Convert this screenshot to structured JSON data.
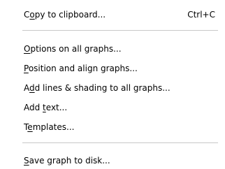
{
  "menu": {
    "items": [
      {
        "pre": "C",
        "mn": "o",
        "post": "py to clipboard...",
        "shortcut": "Ctrl+C"
      },
      {
        "pre": "",
        "mn": "O",
        "post": "ptions on all graphs...",
        "shortcut": ""
      },
      {
        "pre": "",
        "mn": "P",
        "post": "osition and align graphs...",
        "shortcut": ""
      },
      {
        "pre": "A",
        "mn": "d",
        "post": "d lines & shading to all graphs...",
        "shortcut": ""
      },
      {
        "pre": "Add ",
        "mn": "t",
        "post": "ext...",
        "shortcut": ""
      },
      {
        "pre": "T",
        "mn": "e",
        "post": "mplates...",
        "shortcut": ""
      },
      {
        "pre": "",
        "mn": "S",
        "post": "ave graph to disk...",
        "shortcut": ""
      }
    ]
  }
}
